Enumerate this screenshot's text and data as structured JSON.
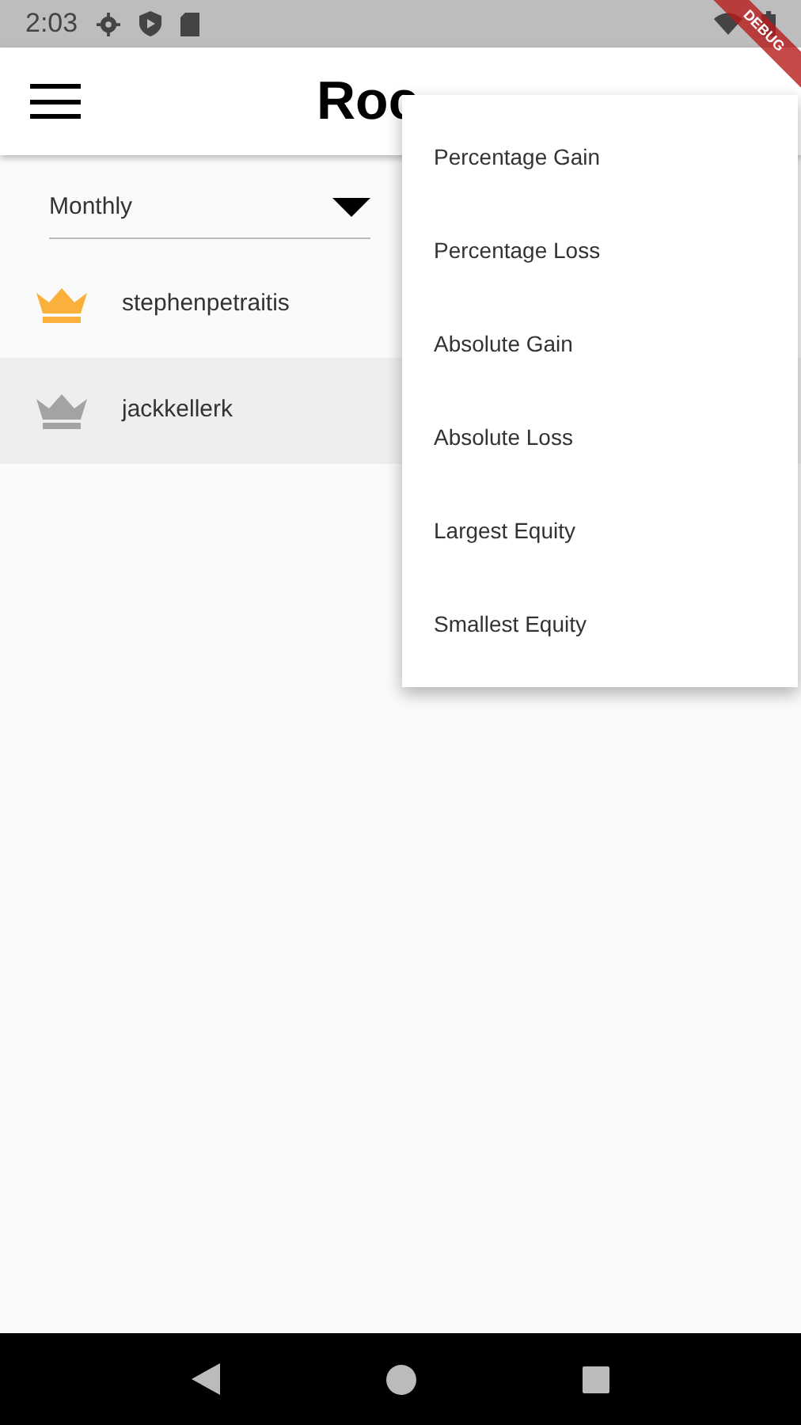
{
  "status_bar": {
    "time": "2:03"
  },
  "debug_banner": {
    "label": "DEBUG"
  },
  "app_bar": {
    "title": "Roc"
  },
  "period_dropdown": {
    "value": "Monthly"
  },
  "leaders": [
    {
      "name": "stephenpetraitis",
      "color": "#f9b13b",
      "selected": false
    },
    {
      "name": "jackkellerk",
      "color": "#a3a3a3",
      "selected": true
    }
  ],
  "sort_menu": [
    "Percentage Gain",
    "Percentage Loss",
    "Absolute Gain",
    "Absolute Loss",
    "Largest Equity",
    "Smallest Equity"
  ]
}
